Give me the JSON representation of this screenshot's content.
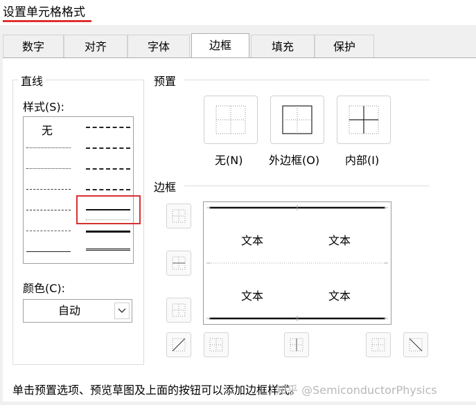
{
  "dialog": {
    "title": "设置单元格格式"
  },
  "tabs": [
    {
      "label": "数字"
    },
    {
      "label": "对齐"
    },
    {
      "label": "字体"
    },
    {
      "label": "边框"
    },
    {
      "label": "填充"
    },
    {
      "label": "保护"
    }
  ],
  "active_tab": "边框",
  "line_group": {
    "title": "直线",
    "style_label": "样式(S):",
    "none_label": "无",
    "color_label": "颜色(C):",
    "color_value": "自动"
  },
  "presets": {
    "title": "预置",
    "items": [
      {
        "label": "无(N)"
      },
      {
        "label": "外边框(O)"
      },
      {
        "label": "内部(I)"
      }
    ]
  },
  "border": {
    "title": "边框",
    "preview_texts": [
      "文本",
      "文本",
      "文本",
      "文本"
    ]
  },
  "footer_text": "单击预置选项、预览草图及上面的按钮可以添加边框样式。",
  "watermark": "知乎 @SemiconductorPhysics",
  "colors": {
    "highlight": "#d83030",
    "tab_bg": "#f0f0f0",
    "border": "#adadad"
  }
}
